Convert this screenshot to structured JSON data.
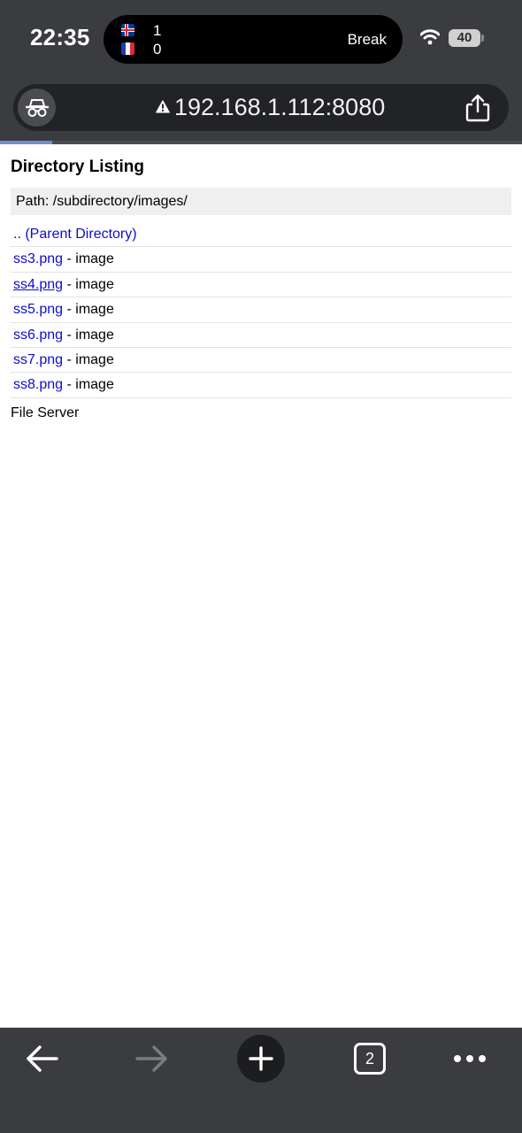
{
  "status_bar": {
    "time": "22:35",
    "battery_level": "40",
    "live_activity": {
      "team_top_flag": "iceland-flag",
      "team_top_score": "1",
      "team_bottom_flag": "france-flag",
      "team_bottom_score": "0",
      "match_status": "Break"
    }
  },
  "browser": {
    "url": "192.168.1.112:8080",
    "security_icon": "warning-triangle-icon",
    "mode_icon": "incognito-icon",
    "load_progress": 0.1
  },
  "page": {
    "title": "Directory Listing",
    "path": "Path: /subdirectory/images/",
    "parent_link": ".. (Parent Directory)",
    "files": [
      {
        "name": "ss3.png",
        "type": "- image"
      },
      {
        "name": "ss4.png",
        "type": "- image"
      },
      {
        "name": "ss5.png",
        "type": "- image"
      },
      {
        "name": "ss6.png",
        "type": "- image"
      },
      {
        "name": "ss7.png",
        "type": "- image"
      },
      {
        "name": "ss8.png",
        "type": "- image"
      }
    ],
    "footer": "File Server"
  },
  "toolbar": {
    "tab_count": "2",
    "icons": [
      "back-arrow-icon",
      "forward-arrow-icon",
      "plus-icon",
      "tabs-icon",
      "more-dots-icon"
    ]
  },
  "colors": {
    "chrome_bg": "#3a3c40",
    "link": "#0c0ccd",
    "path_bg": "#efefef",
    "progress": "#6f8fcf"
  }
}
